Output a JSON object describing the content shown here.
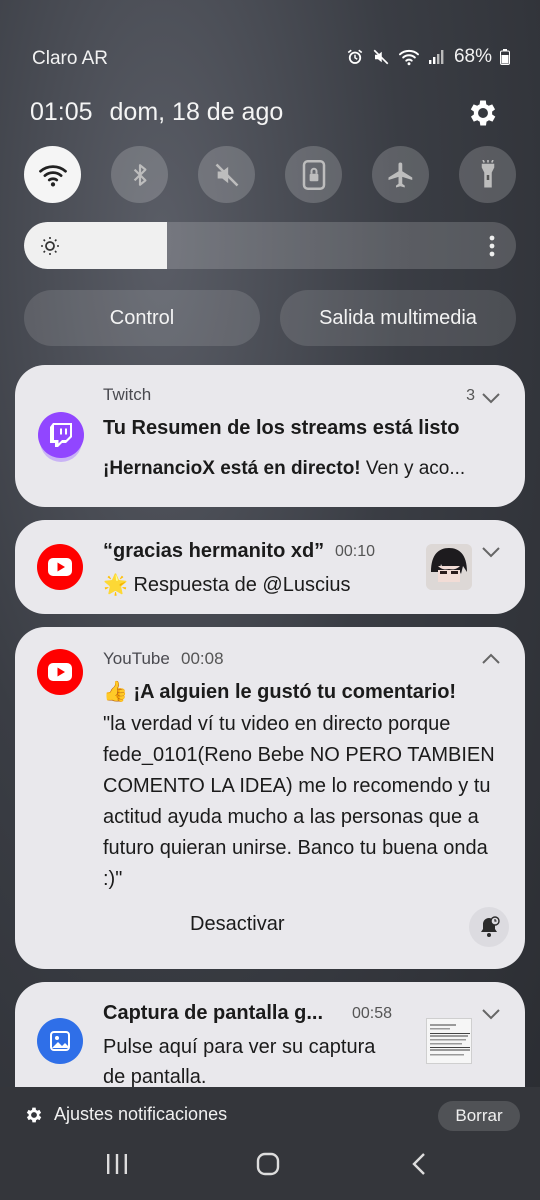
{
  "status_bar": {
    "carrier": "Claro AR",
    "battery": "68%",
    "icons": [
      "alarm-icon",
      "mute-icon",
      "wifi-icon",
      "signal-icon",
      "battery-icon"
    ]
  },
  "header": {
    "time": "01:05",
    "date": "dom, 18 de ago"
  },
  "quick_settings": {
    "tiles": [
      {
        "name": "wifi",
        "active": true
      },
      {
        "name": "bluetooth",
        "active": false
      },
      {
        "name": "mute",
        "active": false
      },
      {
        "name": "rotation-lock",
        "active": false
      },
      {
        "name": "airplane-mode",
        "active": false
      },
      {
        "name": "flashlight",
        "active": false
      }
    ],
    "brightness_level": 0.29
  },
  "pills": {
    "control": "Control",
    "media_output": "Salida multimedia"
  },
  "notifications": {
    "twitch": {
      "app": "Twitch",
      "count": "3",
      "title": "Tu Resumen de los streams está listo",
      "line_bold": "¡HernancioX está en directo!",
      "line_rest": " Ven y aco..."
    },
    "reply": {
      "title": "“gracias hermanito xd”",
      "time": "00:10",
      "line": "🌟 Respuesta de @Luscius"
    },
    "youtube": {
      "app": "YouTube",
      "time": "00:08",
      "title": "👍 ¡A alguien le gustó tu comentario!",
      "body": "\"la verdad ví tu video en directo porque fede_0101(Reno Bebe NO PERO TAMBIEN COMENTO LA IDEA) me lo recomendo y tu actitud ayuda mucho a las personas que a futuro quieran unirse. Banco tu buena onda :)\"",
      "action": "Desactivar"
    },
    "screenshot": {
      "title": "Captura de pantalla g...",
      "time": "00:58",
      "body": "Pulse aquí para ver su captura de pantalla."
    }
  },
  "footer": {
    "settings_label": "Ajustes notificaciones",
    "clear_label": "Borrar"
  }
}
